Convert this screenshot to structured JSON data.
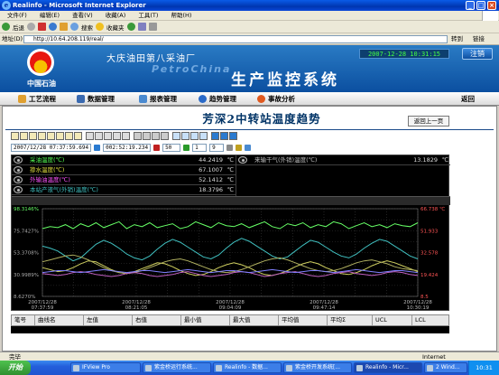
{
  "window": {
    "title": "Realinfo - Microsoft Internet Explorer"
  },
  "menu": [
    "文件(F)",
    "编辑(E)",
    "查看(V)",
    "收藏(A)",
    "工具(T)",
    "帮助(H)"
  ],
  "toolbar": {
    "back": "后退",
    "search": "搜索",
    "favorites": "收藏夹"
  },
  "address": {
    "label": "地址(D)",
    "url": "http://10.64.208.119/real/",
    "go": "转到",
    "links": "链接"
  },
  "header": {
    "company": "中国石油",
    "plant": "大庆油田第八采油厂",
    "petro": "PetroChina",
    "system": "生产监控系统",
    "datetime": "2007-12-28 10:31:15",
    "logout": "注销"
  },
  "nav": [
    {
      "label": "工艺流程"
    },
    {
      "label": "数据管理"
    },
    {
      "label": "报表管理"
    },
    {
      "label": "趋势管理"
    },
    {
      "label": "事故分析"
    }
  ],
  "nav_back": "返回",
  "page": {
    "title": "芳深2中转站温度趋势",
    "back_button": "返回上一页"
  },
  "controls": {
    "start_time": "2007/12/28 07:37:59.694",
    "duration": "002:52:19.234",
    "zoom": "50",
    "page": "1",
    "page_max": "9"
  },
  "legend": [
    {
      "name": "采油温度(℃)",
      "value": "44.2419",
      "unit": "℃",
      "color": "#55ff55"
    },
    {
      "name": "掺水温度(℃)",
      "value": "67.1007",
      "unit": "℃",
      "color": "#e0e040"
    },
    {
      "name": "外输油温度(℃)",
      "value": "52.1412",
      "unit": "℃",
      "color": "#ff55ff"
    },
    {
      "name": "本站产液气(外销)温度(℃)",
      "value": "18.3796",
      "unit": "℃",
      "color": "#40c0c0"
    },
    {
      "name": "来输干气(外销)温度(℃)",
      "value": "13.1829",
      "unit": "℃",
      "color": "#c0c0c0"
    }
  ],
  "chart_data": {
    "type": "line",
    "y_left_ticks": [
      "98.3146%",
      "75.7427%",
      "53.3708%",
      "30.9989%",
      "8.6270%"
    ],
    "y_right_ticks": [
      "66.738 ℃",
      "51.933",
      "32.578",
      "19.424",
      "8.5"
    ],
    "ylim": [
      8.627,
      98.3146
    ],
    "x_labels": [
      {
        "date": "2007/12/28",
        "time": "07:37:59"
      },
      {
        "date": "2007/12/28",
        "time": "08:21:05"
      },
      {
        "date": "2007/12/28",
        "time": "09:04:09"
      },
      {
        "date": "2007/12/28",
        "time": "09:47:14"
      },
      {
        "date": "2007/12/28",
        "time": "10:30:19"
      }
    ],
    "series": [
      {
        "color": "#66ff66",
        "values": [
          78,
          80,
          79,
          82,
          78,
          83,
          80,
          84,
          79,
          82,
          85,
          78,
          82,
          80,
          84,
          79,
          81,
          83,
          78,
          80,
          85,
          82,
          79,
          84,
          81,
          80,
          83,
          79,
          82,
          85,
          80,
          78,
          83,
          81,
          84,
          79,
          82,
          80,
          85,
          83,
          78,
          81,
          84,
          80,
          82,
          79,
          83,
          81,
          80,
          84
        ]
      },
      {
        "color": "#40c0c0",
        "values": [
          60,
          58,
          55,
          50,
          45,
          48,
          55,
          62,
          66,
          63,
          58,
          52,
          48,
          46,
          50,
          57,
          63,
          67,
          64,
          59,
          54,
          49,
          47,
          51,
          58,
          64,
          68,
          65,
          60,
          55,
          50,
          47,
          49,
          55,
          61,
          66,
          64,
          59,
          54,
          50,
          48,
          52,
          58,
          63,
          67,
          65,
          60,
          55,
          50,
          47
        ]
      },
      {
        "color": "#d0d060",
        "values": [
          38,
          36,
          34,
          35,
          38,
          42,
          45,
          44,
          40,
          36,
          33,
          32,
          34,
          37,
          40,
          43,
          42,
          39,
          35,
          32,
          30,
          31,
          34,
          38,
          41,
          43,
          41,
          38,
          34,
          31,
          30,
          32,
          35,
          39,
          42,
          44,
          42,
          38,
          35,
          32,
          31,
          33,
          36,
          40,
          43,
          45,
          43,
          40,
          37,
          34
        ]
      },
      {
        "color": "#b0b060",
        "values": [
          44,
          46,
          48,
          50,
          51,
          49,
          46,
          42,
          38,
          35,
          33,
          32,
          33,
          35,
          38,
          41,
          44,
          46,
          47,
          45,
          42,
          39,
          36,
          34,
          33,
          34,
          36,
          39,
          42,
          45,
          47,
          48,
          46,
          43,
          40,
          37,
          35,
          34,
          35,
          37,
          40,
          43,
          45,
          46,
          44,
          42,
          39,
          37,
          36,
          35
        ]
      },
      {
        "color": "#c060c0",
        "values": [
          32,
          31,
          30,
          31,
          33,
          34,
          33,
          31,
          30,
          29,
          30,
          32,
          33,
          32,
          30,
          29,
          30,
          31,
          33,
          34,
          32,
          30,
          29,
          30,
          31,
          33,
          34,
          33,
          31,
          29,
          30,
          32,
          33,
          34,
          32,
          30,
          29,
          30,
          32,
          33,
          34,
          32,
          31,
          30,
          31,
          33,
          34,
          33,
          31,
          30
        ]
      },
      {
        "color": "#8080ff",
        "values": [
          33,
          34,
          35,
          35,
          34,
          33,
          34,
          35,
          36,
          35,
          34,
          33,
          34,
          35,
          35,
          34,
          33,
          34,
          35,
          36,
          35,
          34,
          33,
          34,
          35,
          35,
          34,
          33,
          34,
          35,
          36,
          35,
          34,
          33,
          34,
          35,
          35,
          34,
          33,
          34,
          35,
          36,
          35,
          34,
          33,
          34,
          35,
          35,
          34,
          33
        ]
      }
    ]
  },
  "stats_header": [
    "笔号",
    "曲线名",
    "左值",
    "右值",
    "最小值",
    "最大值",
    "平均值",
    "平均Σ",
    "UCL",
    "LCL"
  ],
  "status": {
    "left": "完毕",
    "zone": "Internet"
  },
  "taskbar": {
    "start": "开始",
    "items": [
      "IFView Pro",
      "紫金桥运行系统...",
      "Realinfo - 数据...",
      "紫金桥开发系统[...",
      "Realinfo - Micr...",
      "2 Wind..."
    ],
    "clock": "10:31"
  }
}
